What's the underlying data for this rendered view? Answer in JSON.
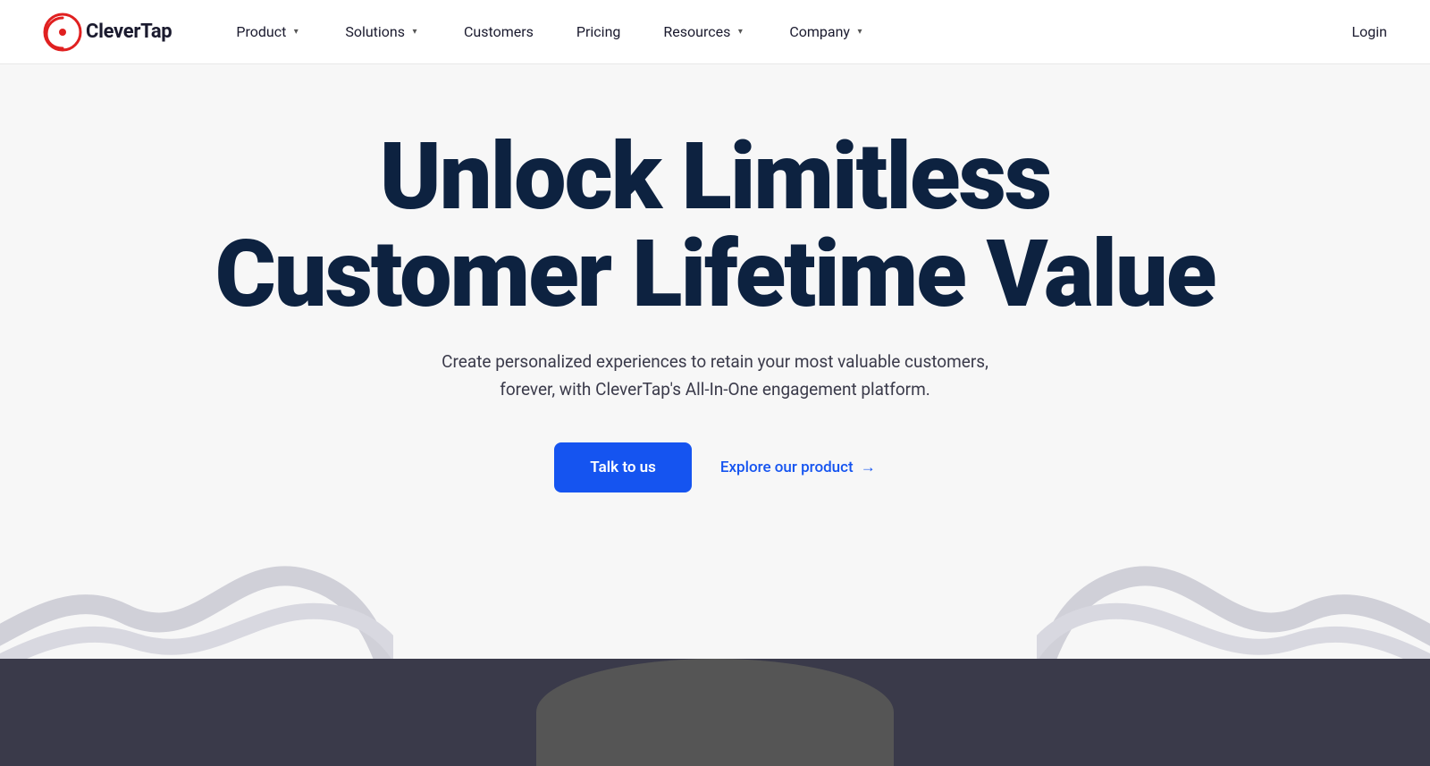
{
  "logo": {
    "text": "CleverTap"
  },
  "nav": {
    "items": [
      {
        "label": "Product",
        "has_dropdown": true
      },
      {
        "label": "Solutions",
        "has_dropdown": true
      },
      {
        "label": "Customers",
        "has_dropdown": false
      },
      {
        "label": "Pricing",
        "has_dropdown": false
      },
      {
        "label": "Resources",
        "has_dropdown": true
      },
      {
        "label": "Company",
        "has_dropdown": true
      }
    ],
    "login_label": "Login"
  },
  "hero": {
    "headline_line1": "Unlock Limitless",
    "headline_line2": "Customer Lifetime Value",
    "subtitle": "Create personalized experiences to retain your most valuable customers, forever, with CleverTap's All-In-One engagement platform.",
    "cta_primary": "Talk to us",
    "cta_secondary": "Explore our product",
    "cta_arrow": "→"
  },
  "colors": {
    "primary_blue": "#1554F0",
    "dark_navy": "#0d2240",
    "body_bg": "#f7f7f7"
  }
}
